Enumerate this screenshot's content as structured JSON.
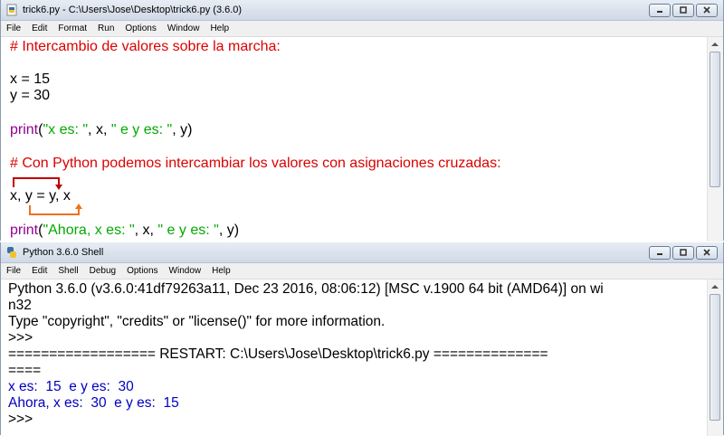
{
  "editor": {
    "title": "trick6.py - C:\\Users\\Jose\\Desktop\\trick6.py (3.6.0)",
    "menu": [
      "File",
      "Edit",
      "Format",
      "Run",
      "Options",
      "Window",
      "Help"
    ],
    "code": {
      "comment1": "# Intercambio de valores sobre la marcha:",
      "x_assign": "x = 15",
      "y_assign": "y = 30",
      "print1_fn": "print",
      "print1_open": "(",
      "print1_str1": "\"x es: \"",
      "print1_mid": ", x, ",
      "print1_str2": "\" e y es: \"",
      "print1_end": ", y)",
      "comment2": "# Con Python podemos intercambiar los valores con asignaciones cruzadas:",
      "swap": "x, y = y, x",
      "print2_fn": "print",
      "print2_open": "(",
      "print2_str1": "\"Ahora, x es: \"",
      "print2_mid": ", x, ",
      "print2_str2": "\" e y es: \"",
      "print2_end": ", y)"
    },
    "colors": {
      "comment": "#dd0000",
      "string": "#00aa00",
      "builtin": "#900090",
      "arrow_red": "#c00000",
      "arrow_orange": "#f07020"
    }
  },
  "shell": {
    "title": "Python 3.6.0 Shell",
    "menu": [
      "File",
      "Edit",
      "Shell",
      "Debug",
      "Options",
      "Window",
      "Help"
    ],
    "lines": [
      "Python 3.6.0 (v3.6.0:41df79263a11, Dec 23 2016, 08:06:12) [MSC v.1900 64 bit (AMD64)] on wi",
      "n32",
      "Type \"copyright\", \"credits\" or \"license()\" for more information.",
      ">>> ",
      "================== RESTART: C:\\Users\\Jose\\Desktop\\trick6.py ==============",
      "====",
      "x es:  15  e y es:  30",
      "Ahora, x es:  30  e y es:  15",
      ">>> "
    ],
    "colors": {
      "output": "#0000c0"
    }
  }
}
